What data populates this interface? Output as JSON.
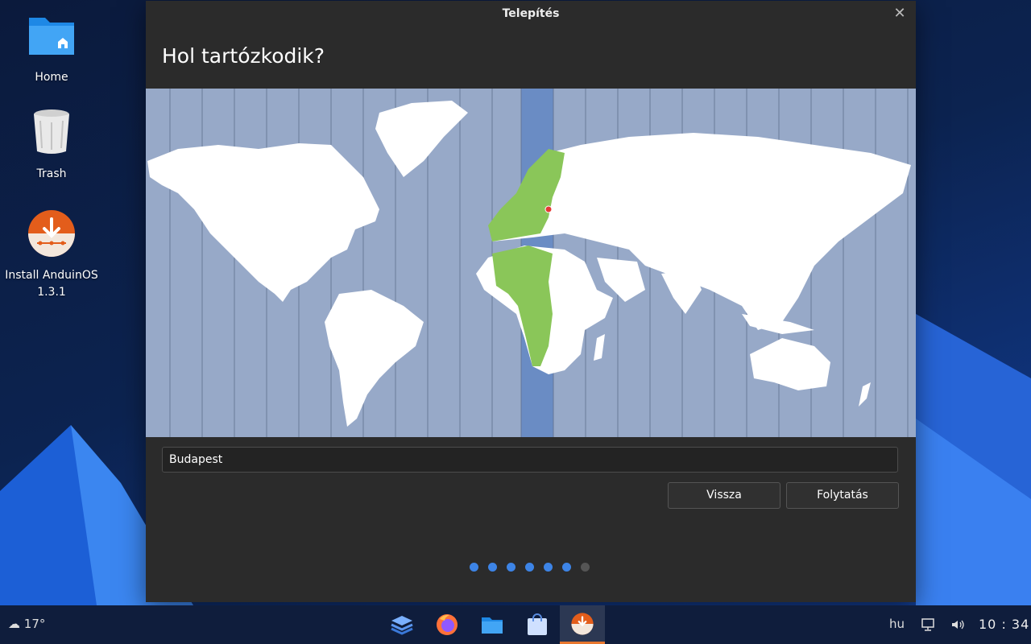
{
  "desktop": {
    "icons": [
      {
        "label": "Home",
        "icon": "folder-home-icon"
      },
      {
        "label": "Trash",
        "icon": "trash-icon"
      },
      {
        "label": "Install AnduinOS 1.3.1",
        "icon": "installer-icon"
      }
    ]
  },
  "window": {
    "title": "Telepítés",
    "heading": "Hol tartózkodik?",
    "city_value": "Budapest",
    "back_label": "Vissza",
    "continue_label": "Folytatás",
    "progress": {
      "total_steps": 7,
      "current_step": 6
    }
  },
  "map": {
    "ocean_color": "#97a9c8",
    "highlight_zone_color": "#6a8cc4",
    "selected_region_color": "#8ac659",
    "land_color": "#ffffff",
    "marker_color": "#e53935"
  },
  "taskbar": {
    "weather": "17°",
    "apps": [
      "layers-icon",
      "firefox-icon",
      "files-icon",
      "store-icon",
      "installer-icon"
    ],
    "language": "hu",
    "clock": "10 : 34"
  }
}
